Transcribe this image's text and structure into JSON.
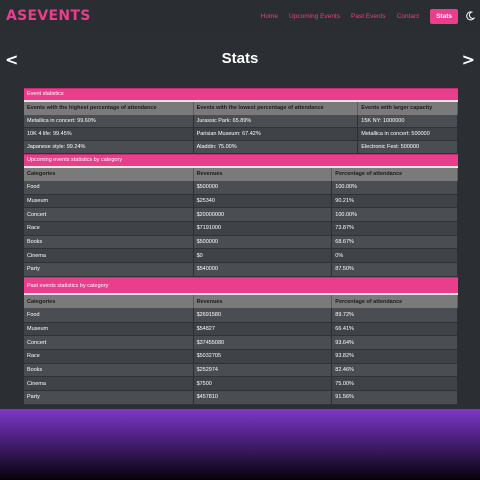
{
  "nav": {
    "logo": "ASEVENTS",
    "links": [
      "Home",
      "Upcoming Events",
      "Past Events",
      "Contact"
    ],
    "active": "Stats"
  },
  "page": {
    "title": "Stats",
    "prev_arrow": "<",
    "next_arrow": ">"
  },
  "event_statistics": {
    "title": "Event statistics",
    "headers": [
      "Events with the highest percentage of attendance",
      "Events with the lowest percentage of attendance",
      "Events with larger capacity"
    ],
    "rows": [
      [
        "Metallica in concert: 99.60%",
        "Jurassic Park: 65.89%",
        "15K NY: 1000000"
      ],
      [
        "10K 4 life: 99.45%",
        "Parisian Museum: 67.42%",
        "Metallica in concert: 500000"
      ],
      [
        "Japanese style: 99.24%",
        "Aladdin: 75.00%",
        "Electronic Fest: 500000"
      ]
    ]
  },
  "upcoming_stats": {
    "title": "Upcoming events statistics by category",
    "headers": [
      "Categories",
      "Revenues",
      "Percentage of attendance"
    ],
    "rows": [
      [
        "Food",
        "$500000",
        "100.00%"
      ],
      [
        "Museum",
        "$25340",
        "90.21%"
      ],
      [
        "Concert",
        "$20000000",
        "100.00%"
      ],
      [
        "Race",
        "$7191000",
        "73.87%"
      ],
      [
        "Books",
        "$500000",
        "68.67%"
      ],
      [
        "Cinema",
        "$0",
        "0%"
      ],
      [
        "Party",
        "$540000",
        "87.50%"
      ]
    ]
  },
  "past_stats": {
    "title": "Past events statistics by category",
    "headers": [
      "Categories",
      "Revenues",
      "Percentage of attendance"
    ],
    "rows": [
      [
        "Food",
        "$2691580",
        "89.72%"
      ],
      [
        "Museum",
        "$54827",
        "66.41%"
      ],
      [
        "Concert",
        "$37455080",
        "93.64%"
      ],
      [
        "Race",
        "$5032705",
        "93.82%"
      ],
      [
        "Books",
        "$252974",
        "82.46%"
      ],
      [
        "Cinema",
        "$7500",
        "75.00%"
      ],
      [
        "Party",
        "$457810",
        "91.56%"
      ]
    ]
  },
  "colors": {
    "accent": "#e83e8c",
    "background": "#2b2f33",
    "header_gray": "#7a7a7a"
  },
  "icons": {
    "theme_toggle": "moon-icon"
  }
}
